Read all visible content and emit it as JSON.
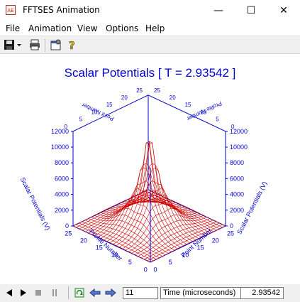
{
  "window": {
    "title": "FFTSES Animation",
    "minimize": "—",
    "maximize": "☐",
    "close": "✕",
    "icon_text": "AE"
  },
  "menu": [
    "File",
    "Animation",
    "View",
    "Options",
    "Help"
  ],
  "chart_data": {
    "type": "surface",
    "title": "Scalar Potentials [ T = 2.93542 ]",
    "axes": {
      "left_z_label": "Scalar Potentials (V)",
      "right_z_label": "Scalar Potentials (V)",
      "front_left_label": "Profile Number",
      "front_right_label": "Point Number",
      "back_left_label": "Point Number",
      "back_right_label": "Profile Number"
    },
    "z_ticks": [
      "0",
      "2000",
      "4000",
      "6000",
      "8000",
      "10000",
      "12000"
    ],
    "profile_ticks": [
      "0",
      "5",
      "10",
      "15",
      "20",
      "25"
    ],
    "point_ticks": [
      "0",
      "5",
      "10",
      "15",
      "20",
      "25"
    ],
    "zlim": [
      0,
      12000
    ],
    "peak_value": 10500,
    "grid_size": 25,
    "surface_color": "#cc0000",
    "axis_color": "#0000cc"
  },
  "status": {
    "frame": "11",
    "time_label": "Time (microseconds)",
    "time_value": "2.93542"
  }
}
